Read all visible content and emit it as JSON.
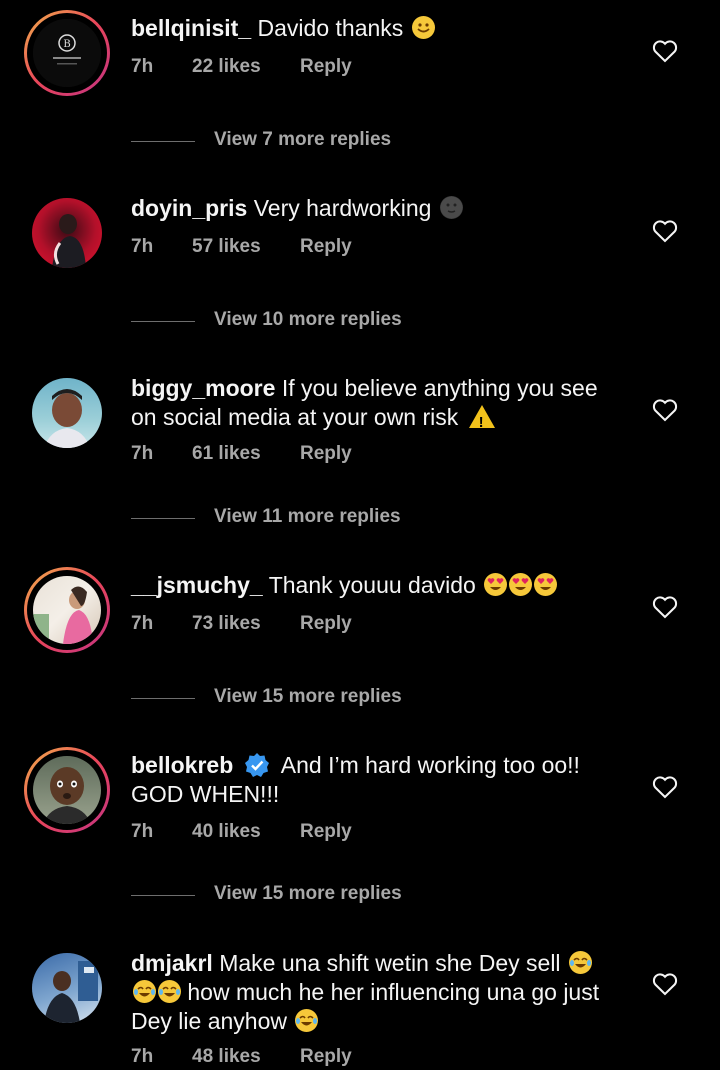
{
  "actions": {
    "reply_label": "Reply"
  },
  "comments": [
    {
      "username": "bellqinisit_",
      "text": "Davido thanks",
      "time": "7h",
      "likes": "22 likes",
      "view_more": "View 7 more replies",
      "avatar_icon": "brand-logo-avatar",
      "story_ring": true
    },
    {
      "username": "doyin_pris",
      "text": "Very hardworking",
      "time": "7h",
      "likes": "57 likes",
      "view_more": "View 10 more replies",
      "avatar_icon": "user-photo-avatar",
      "story_ring": false
    },
    {
      "username": "biggy_moore",
      "text": "If you believe anything you see on social media at your own risk",
      "time": "7h",
      "likes": "61 likes",
      "view_more": "View 11 more replies",
      "avatar_icon": "user-photo-avatar",
      "story_ring": false
    },
    {
      "username": "__jsmuchy_",
      "text": "Thank youuu davido",
      "time": "7h",
      "likes": "73 likes",
      "view_more": "View 15 more replies",
      "avatar_icon": "user-photo-avatar",
      "story_ring": true
    },
    {
      "username": "bellokreb",
      "text": "And I’m hard working too oo!! GOD WHEN!!!",
      "time": "7h",
      "likes": "40 likes",
      "view_more": "View 15 more replies",
      "avatar_icon": "user-photo-avatar",
      "story_ring": true,
      "verified": true
    },
    {
      "username": "dmjakrl",
      "text_parts": [
        "Make una shift wetin she Dey sell",
        "how much he her influencing una go",
        "just Dey lie anyhow"
      ],
      "time": "7h",
      "likes": "48 likes",
      "avatar_icon": "user-photo-avatar",
      "story_ring": false
    }
  ],
  "colors": {
    "background": "#000000",
    "text": "#f5f5f5",
    "secondary": "#a8a8a8",
    "verified": "#3897f0"
  }
}
